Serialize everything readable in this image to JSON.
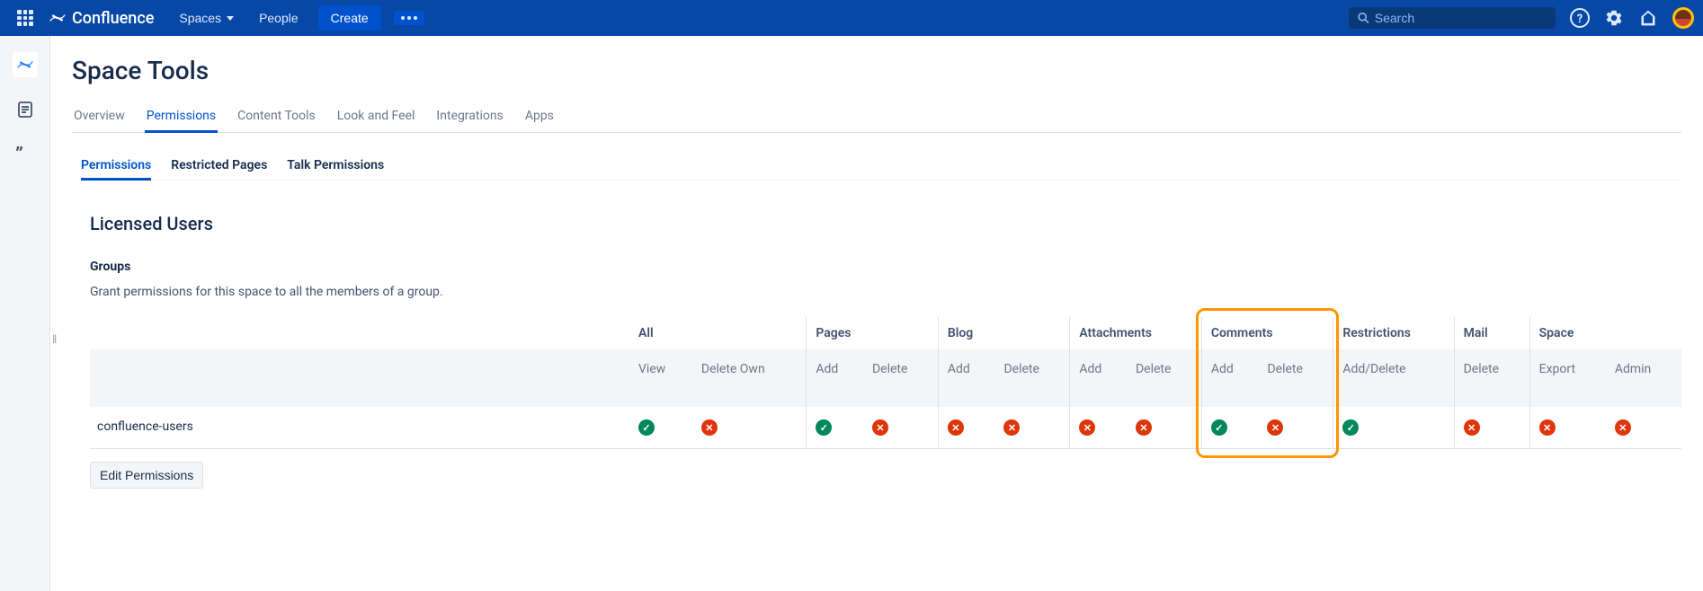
{
  "header": {
    "product": "Confluence",
    "nav": {
      "spaces": "Spaces",
      "people": "People",
      "create": "Create"
    },
    "search_placeholder": "Search"
  },
  "page": {
    "title": "Space Tools",
    "tabs": [
      "Overview",
      "Permissions",
      "Content Tools",
      "Look and Feel",
      "Integrations",
      "Apps"
    ],
    "active_tab": "Permissions",
    "sub_tabs": [
      "Permissions",
      "Restricted Pages",
      "Talk Permissions"
    ],
    "active_sub_tab": "Permissions"
  },
  "section": {
    "heading": "Licensed Users",
    "label": "Groups",
    "desc": "Grant permissions for this space to all the members of a group.",
    "edit_button": "Edit Permissions"
  },
  "perm_groups": [
    "All",
    "Pages",
    "Blog",
    "Attachments",
    "Comments",
    "Restrictions",
    "Mail",
    "Space"
  ],
  "perm_actions": {
    "All": [
      "View",
      "Delete Own"
    ],
    "Pages": [
      "Add",
      "Delete"
    ],
    "Blog": [
      "Add",
      "Delete"
    ],
    "Attachments": [
      "Add",
      "Delete"
    ],
    "Comments": [
      "Add",
      "Delete"
    ],
    "Restrictions": [
      "Add/Delete"
    ],
    "Mail": [
      "Delete"
    ],
    "Space": [
      "Export",
      "Admin"
    ]
  },
  "rows": [
    {
      "name": "confluence-users",
      "perms": {
        "All": [
          true,
          false
        ],
        "Pages": [
          true,
          false
        ],
        "Blog": [
          false,
          false
        ],
        "Attachments": [
          false,
          false
        ],
        "Comments": [
          true,
          false
        ],
        "Restrictions": [
          true
        ],
        "Mail": [
          false
        ],
        "Space": [
          false,
          false
        ]
      }
    }
  ],
  "highlight_group": "Comments"
}
